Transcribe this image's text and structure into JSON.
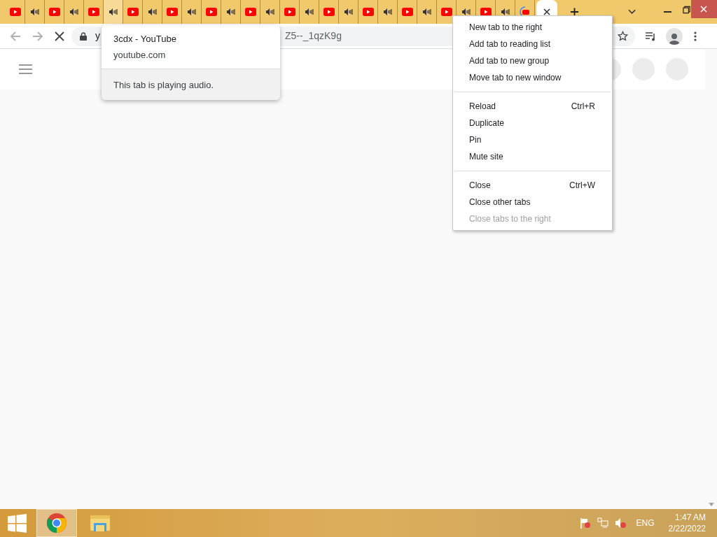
{
  "tabs": [
    {
      "kind": "video",
      "hovered": false,
      "selected": false
    },
    {
      "kind": "audio",
      "hovered": false,
      "selected": false
    },
    {
      "kind": "video",
      "hovered": false,
      "selected": false
    },
    {
      "kind": "audio",
      "hovered": false,
      "selected": false
    },
    {
      "kind": "video",
      "hovered": false,
      "selected": false
    },
    {
      "kind": "audio",
      "hovered": true,
      "selected": false
    },
    {
      "kind": "video",
      "hovered": false,
      "selected": false
    },
    {
      "kind": "audio",
      "hovered": false,
      "selected": false
    },
    {
      "kind": "video",
      "hovered": false,
      "selected": false
    },
    {
      "kind": "audio",
      "hovered": false,
      "selected": false
    },
    {
      "kind": "video",
      "hovered": false,
      "selected": false
    },
    {
      "kind": "audio",
      "hovered": false,
      "selected": false
    },
    {
      "kind": "video",
      "hovered": false,
      "selected": false
    },
    {
      "kind": "audio",
      "hovered": false,
      "selected": false
    },
    {
      "kind": "video",
      "hovered": false,
      "selected": false
    },
    {
      "kind": "audio",
      "hovered": false,
      "selected": false
    },
    {
      "kind": "video",
      "hovered": false,
      "selected": false
    },
    {
      "kind": "audio",
      "hovered": false,
      "selected": false
    },
    {
      "kind": "video",
      "hovered": false,
      "selected": false
    },
    {
      "kind": "audio",
      "hovered": false,
      "selected": false
    },
    {
      "kind": "video",
      "hovered": false,
      "selected": false
    },
    {
      "kind": "audio",
      "hovered": false,
      "selected": false
    },
    {
      "kind": "video",
      "hovered": false,
      "selected": false
    },
    {
      "kind": "audio",
      "hovered": false,
      "selected": false
    },
    {
      "kind": "video",
      "hovered": false,
      "selected": false
    },
    {
      "kind": "audio",
      "hovered": false,
      "selected": false
    },
    {
      "kind": "loading",
      "hovered": false,
      "selected": false
    },
    {
      "kind": "close",
      "hovered": false,
      "selected": true
    }
  ],
  "address_bar": {
    "url_start": "y",
    "url_end": "Z5--_1qzK9g"
  },
  "tab_tooltip": {
    "title": "3cdx - YouTube",
    "domain": "youtube.com",
    "note": "This tab is playing audio."
  },
  "context_menu": [
    {
      "kind": "item",
      "label": "New tab to the right",
      "disabled": false
    },
    {
      "kind": "item",
      "label": "Add tab to reading list",
      "disabled": false
    },
    {
      "kind": "item",
      "label": "Add tab to new group",
      "disabled": false
    },
    {
      "kind": "item",
      "label": "Move tab to new window",
      "disabled": false
    },
    {
      "kind": "separator"
    },
    {
      "kind": "item",
      "label": "Reload",
      "shortcut": "Ctrl+R",
      "disabled": false
    },
    {
      "kind": "item",
      "label": "Duplicate",
      "disabled": false
    },
    {
      "kind": "item",
      "label": "Pin",
      "disabled": false
    },
    {
      "kind": "item",
      "label": "Mute site",
      "disabled": false
    },
    {
      "kind": "separator"
    },
    {
      "kind": "item",
      "label": "Close",
      "shortcut": "Ctrl+W",
      "disabled": false
    },
    {
      "kind": "item",
      "label": "Close other tabs",
      "disabled": false
    },
    {
      "kind": "item",
      "label": "Close tabs to the right",
      "disabled": true
    }
  ],
  "taskbar": {
    "apps": [
      {
        "kind": "chrome",
        "selected": true
      },
      {
        "kind": "explorer",
        "selected": false
      }
    ],
    "language": "ENG",
    "time": "1:47 AM",
    "date": "2/22/2022"
  }
}
